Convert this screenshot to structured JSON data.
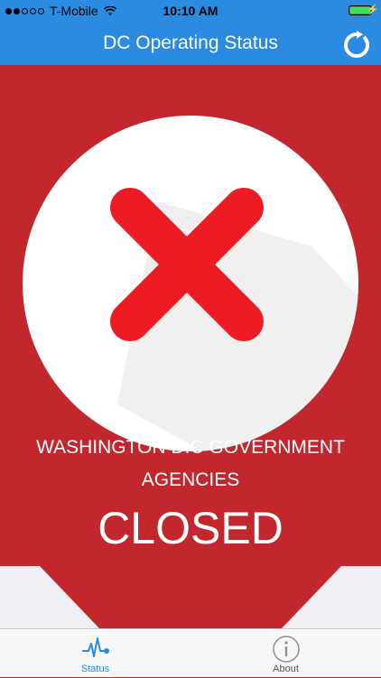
{
  "status_bar": {
    "carrier": "T-Mobile",
    "time": "10:10 AM",
    "signal_bars_filled": 2,
    "signal_bars_total": 5,
    "battery_level": 1.0
  },
  "nav": {
    "title": "DC Operating Status",
    "refresh_icon": "refresh-icon"
  },
  "status_card": {
    "icon": "x-mark-icon",
    "line1": "WASHINGTON D.C GOVERNMENT",
    "line2": "AGENCIES",
    "status": "CLOSED"
  },
  "tabs": [
    {
      "label": "Status",
      "icon": "heartbeat-icon",
      "active": true
    },
    {
      "label": "About",
      "icon": "info-icon",
      "active": false
    }
  ],
  "colors": {
    "nav_blue": "#2a8be0",
    "closed_red": "#c1272d",
    "x_red": "#ed1c24",
    "tab_active": "#2a8be0",
    "tab_inactive": "#8e8e93"
  }
}
